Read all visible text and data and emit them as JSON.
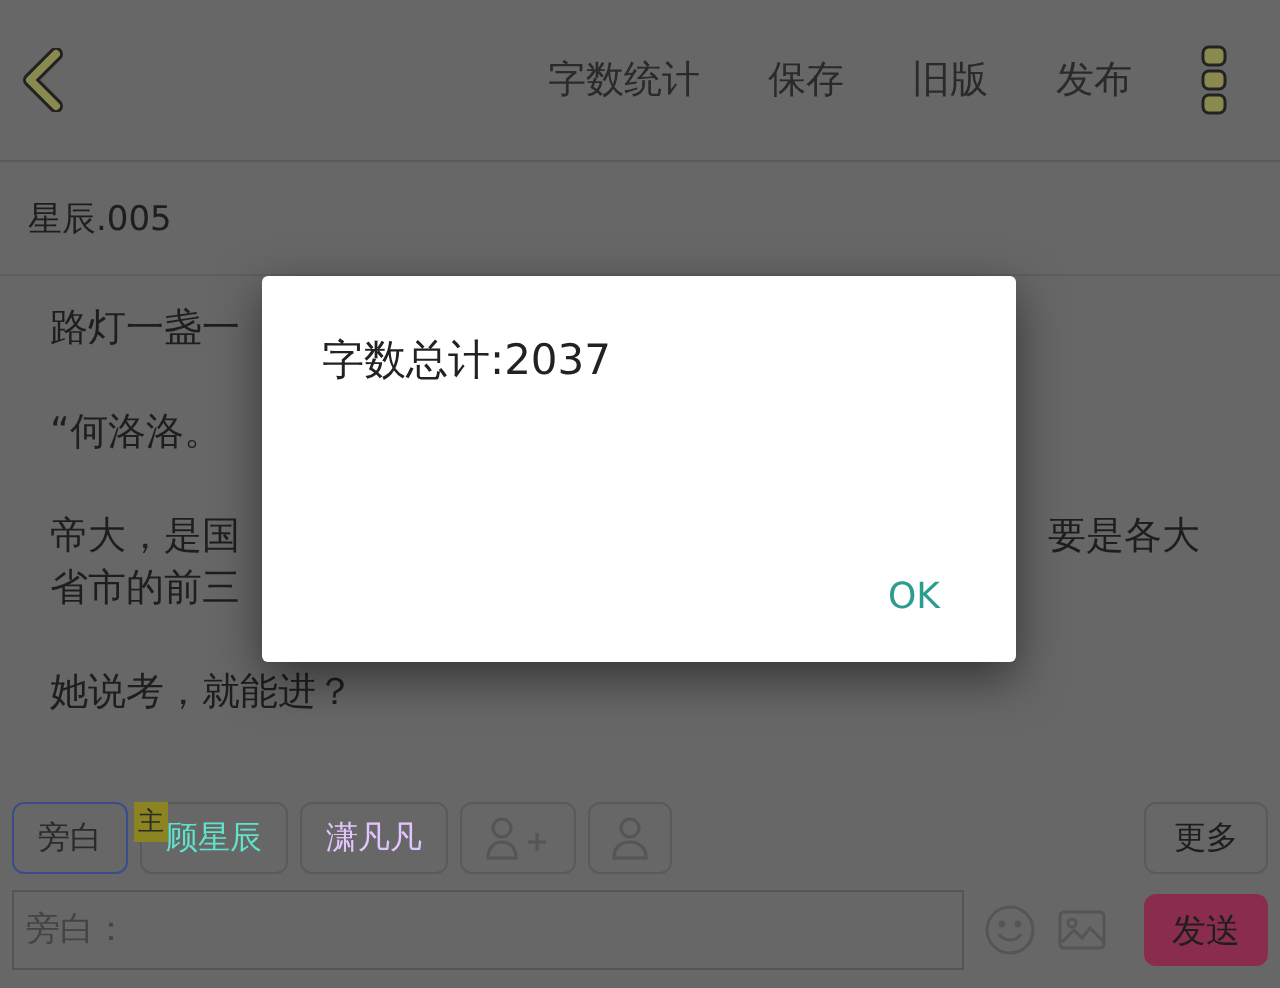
{
  "header": {
    "actions": [
      {
        "label": "字数统计"
      },
      {
        "label": "保存"
      },
      {
        "label": "旧版"
      },
      {
        "label": "发布"
      }
    ]
  },
  "chapter_title": "星辰.005",
  "paragraphs": [
    {
      "lines": [
        {
          "left": "路灯一盏一"
        }
      ]
    },
    {
      "lines": [
        {
          "left": "“何洛洛。"
        }
      ]
    },
    {
      "lines": [
        {
          "left": "帝大，是国",
          "right": "要是各大"
        },
        {
          "left": "省市的前三"
        }
      ]
    },
    {
      "lines": [
        {
          "left": "她说考，就能进？"
        }
      ]
    }
  ],
  "roles": [
    {
      "kind": "role",
      "label": "旁白",
      "selected": true,
      "color": "#2a2a2a"
    },
    {
      "kind": "role",
      "label": "顾星辰",
      "badge": "主",
      "selected": false,
      "color": "#5fe3cc"
    },
    {
      "kind": "role",
      "label": "潇凡凡",
      "selected": false,
      "color": "#e2c4ff"
    },
    {
      "kind": "add",
      "selected": false
    },
    {
      "kind": "person",
      "selected": false
    }
  ],
  "more_button": "更多",
  "input": {
    "placeholder": "旁白："
  },
  "send_button": "发送",
  "dialog": {
    "message": "字数总计:2037",
    "button": "OK"
  }
}
